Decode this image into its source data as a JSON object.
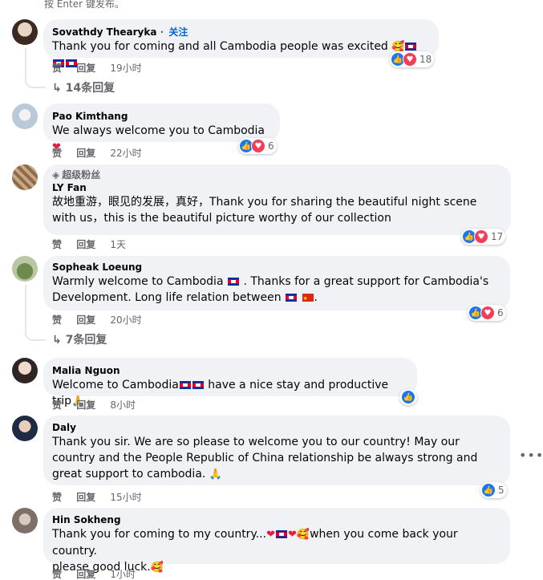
{
  "enter_hint": "按 Enter 键发布。",
  "colors": {
    "like": "#1877f2",
    "love": "#f33e58",
    "link": "#0064d1",
    "bubble": "#f0f2f5"
  },
  "comments": [
    {
      "name": "Sovathdy Thearyka",
      "follow": "关注",
      "text": "Thank you for coming and all Cambodia people was excited",
      "like_label": "赞",
      "reply_label": "回复",
      "time": "19小时",
      "reaction_count": "18",
      "replies": "14条回复"
    },
    {
      "name": "Pao Kimthang",
      "text": "We always welcome you to Cambodia",
      "like_label": "赞",
      "reply_label": "回复",
      "time": "22小时",
      "reaction_count": "6"
    },
    {
      "badge": "超级粉丝",
      "name": "LY Fan",
      "text": "故地重游，眼见的发展，真好，Thank you for sharing the beautiful night scene with us，this is the beautiful picture worthy of our collection",
      "like_label": "赞",
      "reply_label": "回复",
      "time": "1天",
      "reaction_count": "17"
    },
    {
      "name": "Sopheak Loeung",
      "text_a": "Warmly welcome to Cambodia",
      "text_b": ". Thanks for a great support for Cambodia's Development. Long life relation between",
      "text_c": ".",
      "like_label": "赞",
      "reply_label": "回复",
      "time": "20小时",
      "reaction_count": "6",
      "replies": "7条回复"
    },
    {
      "name": "Malia Nguon",
      "text_a": "Welcome to Cambodia",
      "text_b": "have a nice stay and productive trip",
      "like_label": "赞",
      "reply_label": "回复",
      "time": "8小时"
    },
    {
      "name": "Daly",
      "text": "Thank you sir. We are so please to welcome you to our country! May our country and the People Republic of China relationship be always strong and great support to cambodia.",
      "like_label": "赞",
      "reply_label": "回复",
      "time": "15小时",
      "reaction_count": "5"
    },
    {
      "name": "Hin Sokheng",
      "text_a": "Thank you for coming to my country...",
      "text_b": "when you come back your country.",
      "text_c": "please good luck.",
      "like_label": "赞",
      "reply_label": "回复",
      "time": "1小时"
    }
  ],
  "icons": {
    "like": "like-icon",
    "love": "love-icon",
    "reply_arrow": "reply-arrow-icon",
    "more": "more-options-icon"
  }
}
